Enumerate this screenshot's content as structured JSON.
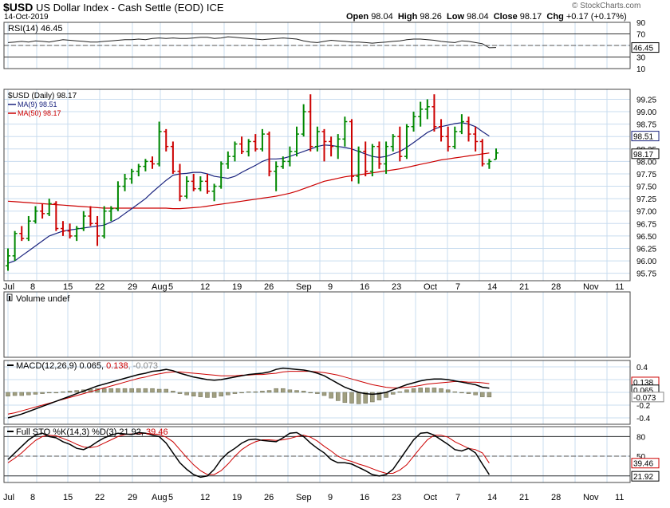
{
  "header": {
    "symbol": "$USD",
    "name": "US Dollar Index - Cash Settle (EOD)",
    "exchange": "ICE",
    "date": "14-Oct-2019",
    "brand": "© StockCharts.com",
    "open_label": "Open",
    "open": "98.04",
    "high_label": "High",
    "high": "98.26",
    "low_label": "Low",
    "low": "98.04",
    "close_label": "Close",
    "close": "98.17",
    "chg_label": "Chg",
    "chg": "+0.17 (+0.17%)"
  },
  "colors": {
    "up": "#008800",
    "down": "#cc0000",
    "ma9": "#1a237e",
    "ma50": "#cc0000",
    "grid": "#c8dcef",
    "volume_bar": "#a09f80",
    "border": "#444444"
  },
  "chart_data": [
    {
      "type": "line",
      "panel": "rsi",
      "label": "RSI(14) 46.45",
      "value_label": "46.45",
      "ticks": [
        "90",
        "70",
        "50",
        "30",
        "10"
      ],
      "ylim": [
        10,
        90
      ],
      "reference_lines": [
        70,
        30
      ],
      "values": [
        55,
        56,
        57,
        56,
        58,
        57,
        56,
        58,
        60,
        59,
        58,
        57,
        56,
        56,
        57,
        58,
        59,
        60,
        60,
        61,
        60,
        62,
        63,
        62,
        63,
        62,
        62,
        63,
        64,
        64,
        62,
        63,
        65,
        64,
        63,
        62,
        61,
        60,
        61,
        62,
        63,
        62,
        61,
        58,
        56,
        55,
        57,
        59,
        58,
        57,
        56,
        56,
        55,
        54,
        55,
        56,
        57,
        58,
        60,
        61,
        61,
        60,
        59,
        57,
        56,
        55,
        58,
        57,
        55,
        53,
        46,
        46.45
      ]
    },
    {
      "type": "ohlc",
      "panel": "price",
      "label": "$USD (Daily) 98.17",
      "ma9_label": "MA(9) 98.51",
      "ma50_label": "MA(50) 98.17",
      "ma9_value": "98.51",
      "close_value": "98.17",
      "ticks": [
        "99.25",
        "99.00",
        "98.75",
        "98.50",
        "98.25",
        "98.00",
        "97.75",
        "97.50",
        "97.25",
        "97.00",
        "96.75",
        "96.50",
        "96.25",
        "96.00",
        "95.75"
      ],
      "ylim": [
        95.6,
        99.45
      ],
      "x_labels": [
        "Jul",
        "8",
        "15",
        "22",
        "29",
        "Aug",
        "5",
        "12",
        "19",
        "26",
        "Sep",
        "9",
        "16",
        "23",
        "Oct",
        "7",
        "14",
        "21",
        "28",
        "Nov",
        "11"
      ],
      "bars": [
        [
          95.9,
          96.25,
          95.8,
          96.1
        ],
        [
          96.1,
          96.6,
          96.0,
          96.55
        ],
        [
          96.55,
          96.7,
          96.4,
          96.45
        ],
        [
          96.45,
          96.9,
          96.4,
          96.8
        ],
        [
          96.8,
          97.1,
          96.75,
          97.0
        ],
        [
          97.0,
          97.15,
          96.85,
          96.95
        ],
        [
          96.95,
          97.25,
          96.9,
          97.15
        ],
        [
          97.15,
          97.2,
          96.6,
          96.65
        ],
        [
          96.65,
          96.8,
          96.5,
          96.6
        ],
        [
          96.6,
          96.75,
          96.45,
          96.5
        ],
        [
          96.5,
          96.7,
          96.4,
          96.65
        ],
        [
          96.65,
          97.0,
          96.6,
          96.9
        ],
        [
          96.9,
          97.1,
          96.7,
          96.75
        ],
        [
          96.75,
          96.9,
          96.3,
          96.5
        ],
        [
          96.5,
          97.1,
          96.45,
          97.0
        ],
        [
          97.0,
          97.1,
          96.8,
          97.05
        ],
        [
          97.05,
          97.6,
          97.0,
          97.5
        ],
        [
          97.5,
          97.75,
          97.4,
          97.65
        ],
        [
          97.65,
          97.85,
          97.55,
          97.8
        ],
        [
          97.8,
          97.95,
          97.7,
          97.9
        ],
        [
          97.9,
          98.05,
          97.8,
          98.0
        ],
        [
          98.0,
          98.1,
          97.85,
          97.95
        ],
        [
          97.95,
          98.8,
          97.9,
          98.6
        ],
        [
          98.6,
          98.65,
          98.2,
          98.3
        ],
        [
          98.3,
          98.4,
          97.75,
          97.8
        ],
        [
          97.8,
          97.95,
          97.2,
          97.3
        ],
        [
          97.3,
          97.7,
          97.25,
          97.6
        ],
        [
          97.6,
          97.75,
          97.4,
          97.45
        ],
        [
          97.45,
          97.7,
          97.4,
          97.6
        ],
        [
          97.6,
          97.75,
          97.35,
          97.4
        ],
        [
          97.4,
          97.55,
          97.2,
          97.5
        ],
        [
          97.5,
          98.0,
          97.45,
          97.95
        ],
        [
          97.95,
          98.2,
          97.85,
          98.1
        ],
        [
          98.1,
          98.4,
          98.0,
          98.35
        ],
        [
          98.35,
          98.5,
          98.15,
          98.2
        ],
        [
          98.2,
          98.45,
          98.1,
          98.4
        ],
        [
          98.4,
          98.55,
          98.2,
          98.25
        ],
        [
          98.25,
          98.65,
          98.2,
          98.55
        ],
        [
          98.55,
          98.6,
          97.7,
          97.8
        ],
        [
          97.8,
          98.0,
          97.4,
          97.9
        ],
        [
          97.9,
          98.1,
          97.85,
          98.0
        ],
        [
          98.0,
          98.3,
          97.9,
          98.2
        ],
        [
          98.2,
          98.7,
          98.1,
          98.55
        ],
        [
          98.55,
          99.15,
          98.5,
          99.0
        ],
        [
          99.0,
          99.35,
          98.2,
          98.3
        ],
        [
          98.3,
          98.7,
          98.2,
          98.6
        ],
        [
          98.6,
          98.65,
          98.0,
          98.4
        ],
        [
          98.4,
          98.5,
          98.1,
          98.3
        ],
        [
          98.3,
          98.55,
          98.05,
          98.45
        ],
        [
          98.45,
          98.9,
          98.3,
          98.8
        ],
        [
          98.8,
          98.85,
          97.6,
          97.7
        ],
        [
          97.7,
          98.3,
          97.55,
          98.2
        ],
        [
          98.2,
          98.4,
          97.7,
          97.8
        ],
        [
          97.8,
          98.35,
          97.7,
          98.3
        ],
        [
          98.3,
          98.4,
          97.85,
          97.95
        ],
        [
          97.95,
          98.4,
          97.75,
          98.3
        ],
        [
          98.3,
          98.55,
          98.2,
          98.5
        ],
        [
          98.5,
          98.7,
          98.0,
          98.1
        ],
        [
          98.1,
          98.75,
          98.05,
          98.7
        ],
        [
          98.7,
          99.0,
          98.6,
          98.9
        ],
        [
          98.9,
          99.2,
          98.7,
          99.05
        ],
        [
          99.05,
          99.25,
          98.85,
          99.1
        ],
        [
          99.1,
          99.35,
          98.6,
          98.7
        ],
        [
          98.7,
          98.85,
          98.4,
          98.5
        ],
        [
          98.5,
          98.7,
          98.2,
          98.3
        ],
        [
          98.3,
          98.7,
          98.25,
          98.6
        ],
        [
          98.6,
          98.95,
          98.55,
          98.8
        ],
        [
          98.8,
          98.9,
          98.4,
          98.55
        ],
        [
          98.55,
          98.7,
          98.2,
          98.4
        ],
        [
          98.4,
          98.45,
          97.9,
          97.95
        ],
        [
          97.95,
          98.05,
          97.85,
          98.0
        ],
        [
          98.04,
          98.26,
          98.04,
          98.17
        ]
      ],
      "ma9": [
        95.95,
        96.0,
        96.1,
        96.2,
        96.3,
        96.4,
        96.5,
        96.55,
        96.6,
        96.62,
        96.64,
        96.66,
        96.68,
        96.7,
        96.72,
        96.78,
        96.85,
        96.95,
        97.05,
        97.15,
        97.25,
        97.38,
        97.5,
        97.62,
        97.72,
        97.75,
        97.76,
        97.78,
        97.78,
        97.75,
        97.7,
        97.68,
        97.66,
        97.7,
        97.78,
        97.85,
        97.92,
        98.0,
        98.05,
        98.05,
        98.06,
        98.1,
        98.15,
        98.2,
        98.25,
        98.3,
        98.33,
        98.32,
        98.3,
        98.28,
        98.25,
        98.2,
        98.15,
        98.1,
        98.08,
        98.1,
        98.15,
        98.2,
        98.28,
        98.38,
        98.48,
        98.58,
        98.65,
        98.7,
        98.73,
        98.76,
        98.78,
        98.75,
        98.7,
        98.6,
        98.51
      ],
      "ma50": [
        97.2,
        97.19,
        97.18,
        97.17,
        97.16,
        97.15,
        97.14,
        97.13,
        97.12,
        97.11,
        97.1,
        97.09,
        97.08,
        97.07,
        97.06,
        97.06,
        97.06,
        97.06,
        97.06,
        97.06,
        97.06,
        97.06,
        97.06,
        97.06,
        97.05,
        97.05,
        97.06,
        97.07,
        97.08,
        97.1,
        97.12,
        97.14,
        97.16,
        97.18,
        97.2,
        97.22,
        97.24,
        97.26,
        97.28,
        97.3,
        97.33,
        97.36,
        97.4,
        97.45,
        97.5,
        97.55,
        97.6,
        97.63,
        97.66,
        97.69,
        97.71,
        97.73,
        97.75,
        97.77,
        97.79,
        97.81,
        97.83,
        97.85,
        97.88,
        97.91,
        97.94,
        97.97,
        98.0,
        98.03,
        98.05,
        98.07,
        98.09,
        98.11,
        98.13,
        98.15,
        98.17
      ]
    },
    {
      "type": "bar",
      "panel": "volume",
      "label": "Volume undef",
      "values": []
    },
    {
      "type": "line",
      "panel": "macd",
      "label": "MACD(12,26,9)",
      "macd_value": "0.065",
      "signal_value": "0.138",
      "hist_value": "-0.073",
      "ticks": [
        "0.4",
        "0.2",
        "0.0",
        "-0.2",
        "-0.4"
      ],
      "axis_labels": [
        "0.138",
        "0.065",
        "-0.073"
      ],
      "ylim": [
        -0.5,
        0.5
      ],
      "macd": [
        -0.4,
        -0.37,
        -0.34,
        -0.3,
        -0.26,
        -0.22,
        -0.18,
        -0.14,
        -0.1,
        -0.06,
        -0.02,
        0.02,
        0.06,
        0.1,
        0.13,
        0.16,
        0.19,
        0.22,
        0.25,
        0.28,
        0.3,
        0.33,
        0.34,
        0.36,
        0.34,
        0.3,
        0.27,
        0.24,
        0.22,
        0.2,
        0.19,
        0.2,
        0.22,
        0.24,
        0.26,
        0.28,
        0.29,
        0.3,
        0.32,
        0.36,
        0.38,
        0.37,
        0.36,
        0.35,
        0.33,
        0.3,
        0.26,
        0.2,
        0.14,
        0.08,
        0.04,
        0.0,
        -0.02,
        -0.03,
        -0.02,
        0.0,
        0.04,
        0.08,
        0.12,
        0.15,
        0.18,
        0.2,
        0.21,
        0.21,
        0.2,
        0.18,
        0.16,
        0.14,
        0.12,
        0.08,
        0.065
      ],
      "signal": [
        -0.34,
        -0.32,
        -0.29,
        -0.26,
        -0.23,
        -0.2,
        -0.17,
        -0.14,
        -0.11,
        -0.08,
        -0.05,
        -0.02,
        0.01,
        0.04,
        0.07,
        0.1,
        0.13,
        0.16,
        0.19,
        0.22,
        0.24,
        0.27,
        0.29,
        0.31,
        0.32,
        0.32,
        0.31,
        0.3,
        0.29,
        0.28,
        0.27,
        0.26,
        0.26,
        0.26,
        0.27,
        0.27,
        0.28,
        0.28,
        0.29,
        0.3,
        0.32,
        0.33,
        0.33,
        0.33,
        0.33,
        0.32,
        0.31,
        0.29,
        0.27,
        0.24,
        0.21,
        0.18,
        0.15,
        0.12,
        0.1,
        0.08,
        0.07,
        0.07,
        0.08,
        0.09,
        0.11,
        0.13,
        0.14,
        0.15,
        0.16,
        0.17,
        0.17,
        0.16,
        0.16,
        0.15,
        0.138
      ],
      "histogram": [
        -0.06,
        -0.05,
        -0.05,
        -0.04,
        -0.03,
        -0.02,
        -0.01,
        0.0,
        0.01,
        0.02,
        0.03,
        0.04,
        0.05,
        0.06,
        0.06,
        0.06,
        0.06,
        0.06,
        0.06,
        0.06,
        0.06,
        0.06,
        0.05,
        0.05,
        0.02,
        -0.02,
        -0.04,
        -0.06,
        -0.07,
        -0.08,
        -0.08,
        -0.06,
        -0.04,
        -0.02,
        -0.01,
        0.01,
        0.01,
        0.02,
        0.03,
        0.06,
        0.06,
        0.04,
        0.03,
        0.02,
        0.0,
        -0.02,
        -0.05,
        -0.09,
        -0.13,
        -0.16,
        -0.17,
        -0.18,
        -0.17,
        -0.15,
        -0.12,
        -0.08,
        -0.03,
        0.01,
        0.04,
        0.06,
        0.07,
        0.07,
        0.07,
        0.06,
        0.04,
        0.01,
        -0.01,
        -0.02,
        -0.04,
        -0.07,
        -0.073
      ]
    },
    {
      "type": "line",
      "panel": "stochastic",
      "label": "Full STO %K(14,3) %D(3)",
      "k_value": "21.92",
      "d_value": "39.46",
      "ticks": [
        "80",
        "50",
        "20"
      ],
      "axis_labels": [
        "39.46",
        "21.92"
      ],
      "ylim": [
        10,
        95
      ],
      "reference_lines": [
        80,
        50,
        20
      ],
      "k": [
        45,
        55,
        65,
        75,
        82,
        85,
        80,
        78,
        72,
        68,
        62,
        60,
        65,
        72,
        78,
        82,
        85,
        84,
        83,
        86,
        85,
        82,
        80,
        70,
        55,
        40,
        30,
        22,
        18,
        20,
        30,
        45,
        55,
        62,
        70,
        75,
        76,
        74,
        73,
        72,
        78,
        85,
        86,
        80,
        70,
        62,
        55,
        45,
        40,
        40,
        38,
        33,
        28,
        22,
        20,
        22,
        30,
        45,
        60,
        75,
        85,
        86,
        82,
        75,
        68,
        60,
        58,
        62,
        55,
        38,
        21.92
      ],
      "d": [
        40,
        47,
        55,
        65,
        74,
        80,
        82,
        81,
        77,
        73,
        68,
        64,
        63,
        65,
        70,
        75,
        80,
        83,
        84,
        84,
        85,
        84,
        83,
        79,
        72,
        60,
        48,
        37,
        28,
        22,
        22,
        28,
        38,
        50,
        60,
        67,
        72,
        75,
        75,
        74,
        75,
        77,
        80,
        82,
        79,
        73,
        65,
        58,
        50,
        45,
        42,
        38,
        35,
        31,
        27,
        24,
        24,
        29,
        37,
        50,
        63,
        75,
        82,
        82,
        79,
        72,
        67,
        62,
        60,
        55,
        39.46
      ]
    }
  ]
}
